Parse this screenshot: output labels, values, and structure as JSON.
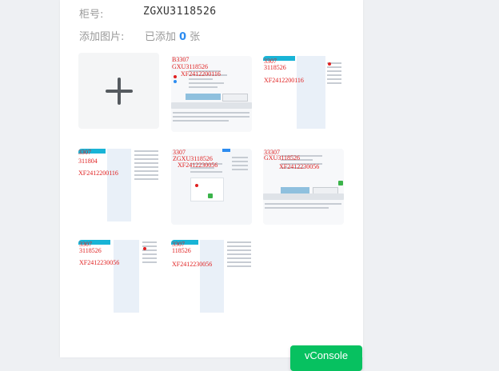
{
  "form": {
    "box_label": "柜号:",
    "box_value": "ZGXU3118526",
    "image_label": "添加图片:",
    "added_prefix": "已添加",
    "added_count": "0",
    "added_suffix": "张"
  },
  "thumbnails": [
    {
      "lines": [
        "B3307",
        "GXU3118526",
        "XF2412200116"
      ]
    },
    {
      "lines": [
        "3307",
        "3118526",
        "XF2412200116"
      ]
    },
    {
      "lines": [
        "3307",
        "311804",
        "XF2412200116"
      ]
    },
    {
      "lines": [
        "3307",
        "ZGXU3118526",
        "XF2412230056"
      ]
    },
    {
      "lines": [
        "33307",
        "GXU3118526",
        "XF2412230056"
      ]
    },
    {
      "lines": [
        "3307",
        "3118526",
        "XF2412230056"
      ]
    },
    {
      "lines": [
        "3307",
        "118526",
        "XF2412230056"
      ]
    }
  ],
  "vconsole": {
    "label": "vConsole"
  }
}
